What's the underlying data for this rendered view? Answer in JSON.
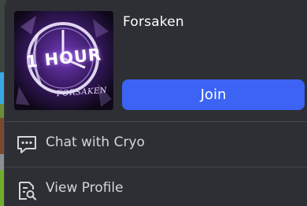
{
  "game": {
    "title": "Forsaken",
    "thumbnail_text_main": "1 HOUR",
    "thumbnail_text_sub": "FORSAKEN"
  },
  "join_button": {
    "label": "Join"
  },
  "menu": [
    {
      "label": "Chat with Cryo",
      "icon": "chat-bubble-icon"
    },
    {
      "label": "View Profile",
      "icon": "profile-search-icon"
    }
  ],
  "colors": {
    "panel_bg": "#2d2f34",
    "join_blue": "#3c63f4",
    "text_primary": "#ffffff",
    "text_menu": "#d4d6da",
    "divider": "#43464c",
    "thumbnail_purple": "#7a3fc9"
  }
}
